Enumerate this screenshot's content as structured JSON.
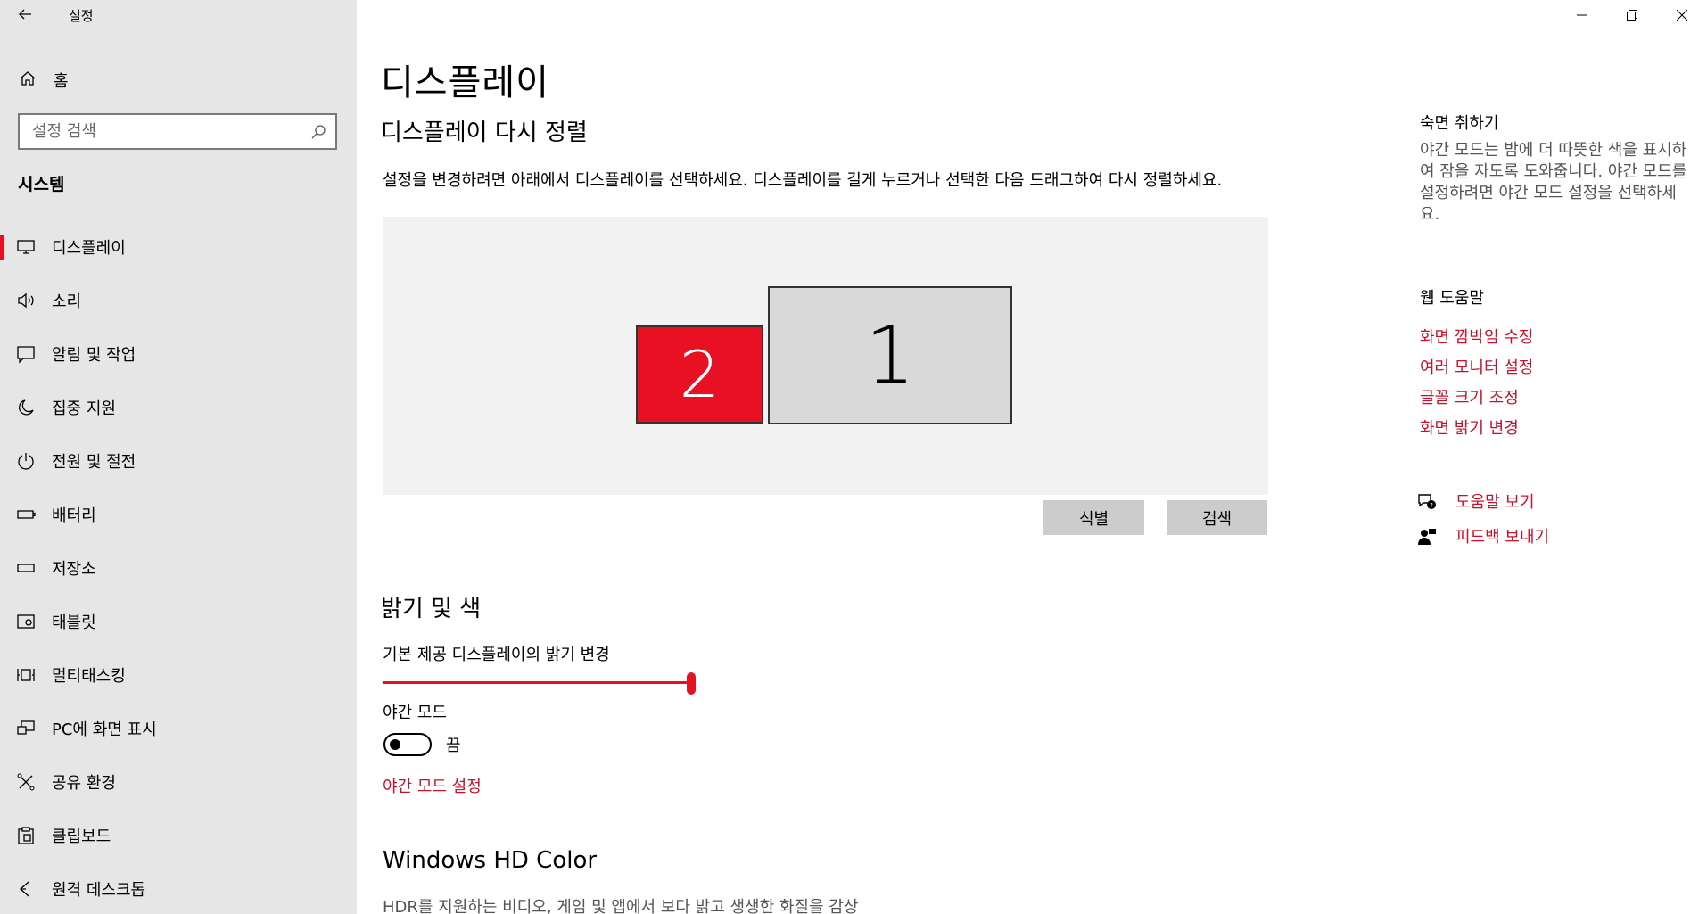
{
  "app": {
    "title": "설정"
  },
  "sidebar": {
    "home_label": "홈",
    "search_placeholder": "설정 검색",
    "section_title": "시스템",
    "items": [
      {
        "label": "디스플레이",
        "icon": "monitor-icon",
        "active": true
      },
      {
        "label": "소리",
        "icon": "speaker-icon"
      },
      {
        "label": "알림 및 작업",
        "icon": "notification-icon"
      },
      {
        "label": "집중 지원",
        "icon": "moon-icon"
      },
      {
        "label": "전원 및 절전",
        "icon": "power-icon"
      },
      {
        "label": "배터리",
        "icon": "battery-icon"
      },
      {
        "label": "저장소",
        "icon": "storage-icon"
      },
      {
        "label": "태블릿",
        "icon": "tablet-icon"
      },
      {
        "label": "멀티태스킹",
        "icon": "multitasking-icon"
      },
      {
        "label": "PC에 화면 표시",
        "icon": "project-icon"
      },
      {
        "label": "공유 환경",
        "icon": "shared-experience-icon"
      },
      {
        "label": "클립보드",
        "icon": "clipboard-icon"
      },
      {
        "label": "원격 데스크톱",
        "icon": "remote-desktop-icon"
      }
    ]
  },
  "main": {
    "page_title": "디스플레이",
    "rearrange_title": "디스플레이 다시 정렬",
    "rearrange_desc": "설정을 변경하려면 아래에서 디스플레이를 선택하세요. 디스플레이를 길게 누르거나 선택한 다음 드래그하여 다시 정렬하세요.",
    "monitors": [
      {
        "number": "2",
        "selected": true,
        "color": "#e81123"
      },
      {
        "number": "1",
        "selected": false,
        "color": "#d9d9d9"
      }
    ],
    "identify_label": "식별",
    "detect_label": "검색",
    "brightness_title": "밝기 및 색",
    "brightness_label": "기본 제공 디스플레이의 밝기 변경",
    "brightness_value": 100,
    "night_light_label": "야간 모드",
    "night_light_state": "끔",
    "night_light_settings_link": "야간 모드 설정",
    "hdr_title": "Windows HD Color",
    "hdr_desc": "HDR를 지원하는 비디오, 게임 및 앱에서 보다 밝고 생생한 화질을 감상"
  },
  "right_panel": {
    "sleep_title": "숙면 취하기",
    "sleep_desc": "야간 모드는 밤에 더 따뜻한 색을 표시하여 잠을 자도록 도와줍니다. 야간 모드를 설정하려면 야간 모드 설정을 선택하세요.",
    "web_help_title": "웹 도움말",
    "links": [
      "화면 깜박임 수정",
      "여러 모니터 설정",
      "글꼴 크기 조정",
      "화면 밝기 변경"
    ],
    "get_help": "도움말 보기",
    "give_feedback": "피드백 보내기"
  },
  "colors": {
    "accent": "#e81123",
    "link": "#c9102b",
    "sidebar_bg": "#e6e6e6"
  }
}
